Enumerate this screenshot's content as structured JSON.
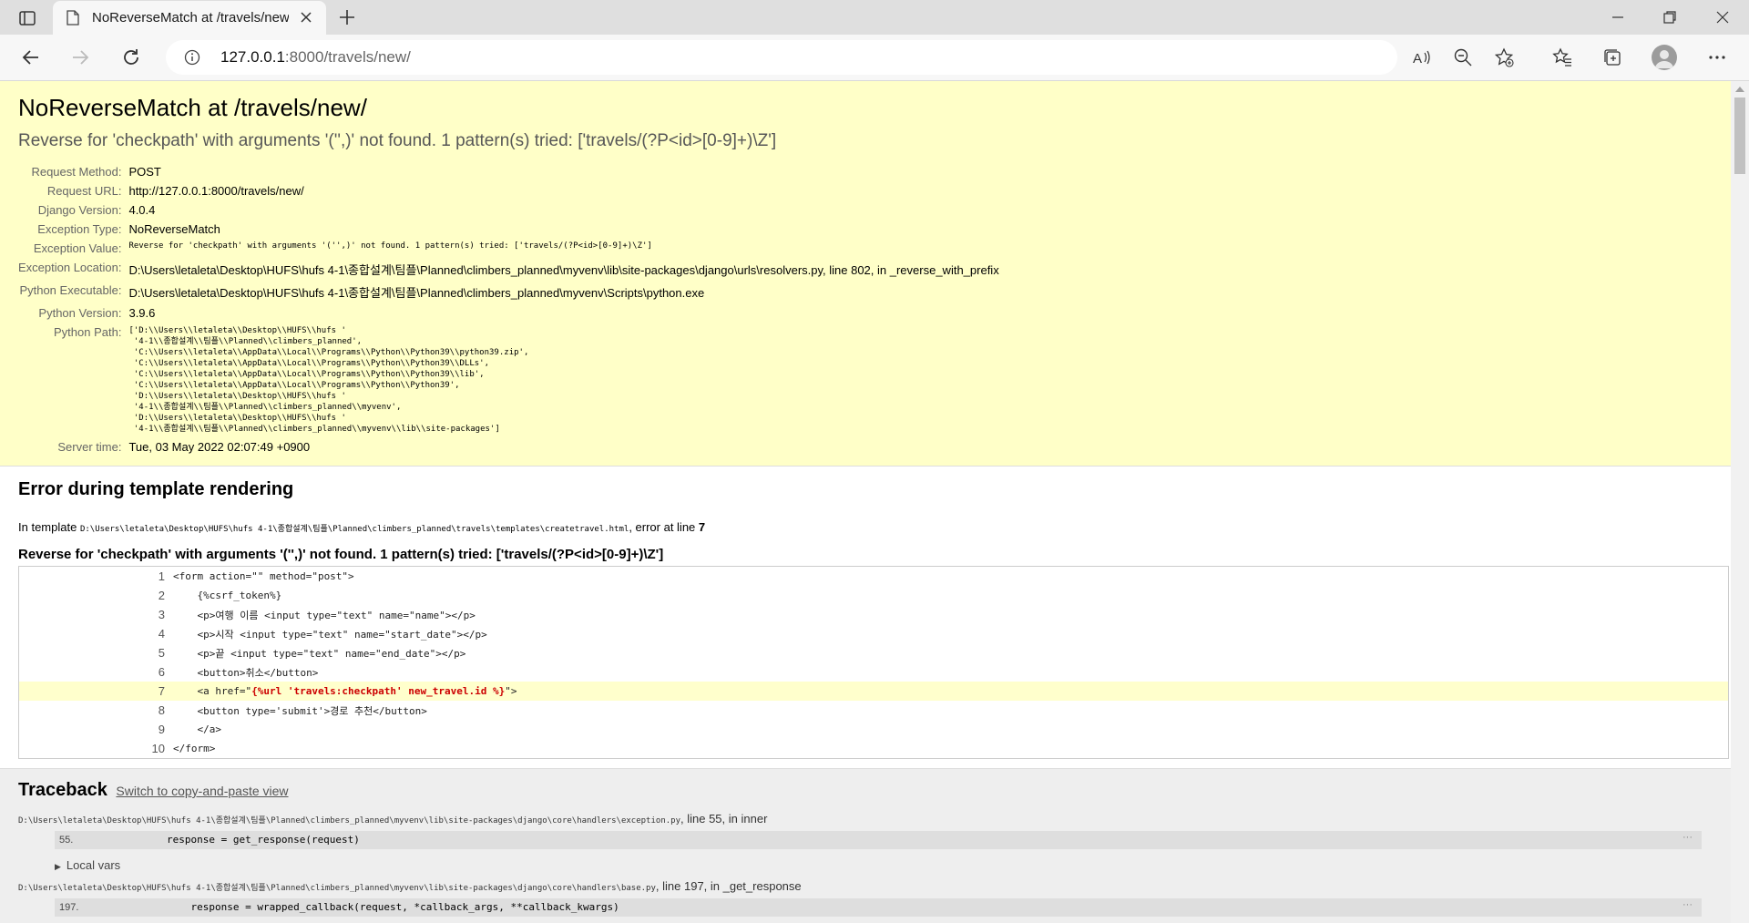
{
  "browser": {
    "tab_title": "NoReverseMatch at /travels/new/",
    "url_host": "127.0.0.1",
    "url_rest": ":8000/travels/new/"
  },
  "summary": {
    "heading": "NoReverseMatch at /travels/new/",
    "exception_value": "Reverse for 'checkpath' with arguments '('',)' not found. 1 pattern(s) tried: ['travels/(?P<id>[0-9]+)\\Z']",
    "rows": [
      {
        "label": "Request Method:",
        "value": "POST"
      },
      {
        "label": "Request URL:",
        "value": "http://127.0.0.1:8000/travels/new/"
      },
      {
        "label": "Django Version:",
        "value": "4.0.4"
      },
      {
        "label": "Exception Type:",
        "value": "NoReverseMatch"
      },
      {
        "label": "Exception Value:",
        "value": "Reverse for 'checkpath' with arguments '('',)' not found. 1 pattern(s) tried: ['travels/(?P<id>[0-9]+)\\Z']"
      },
      {
        "label": "Exception Location:",
        "value": "D:\\Users\\letaleta\\Desktop\\HUFS\\hufs 4-1\\종합설계\\팀플\\Planned\\climbers_planned\\myvenv\\lib\\site-packages\\django\\urls\\resolvers.py, line 802, in _reverse_with_prefix"
      },
      {
        "label": "Python Executable:",
        "value": "D:\\Users\\letaleta\\Desktop\\HUFS\\hufs 4-1\\종합설계\\팀플\\Planned\\climbers_planned\\myvenv\\Scripts\\python.exe"
      },
      {
        "label": "Python Version:",
        "value": "3.9.6"
      },
      {
        "label": "Python Path:",
        "value": "['D:\\\\Users\\\\letaleta\\\\Desktop\\\\HUFS\\\\hufs '\n '4-1\\\\종합설계\\\\팀플\\\\Planned\\\\climbers_planned',\n 'C:\\\\Users\\\\letaleta\\\\AppData\\\\Local\\\\Programs\\\\Python\\\\Python39\\\\python39.zip',\n 'C:\\\\Users\\\\letaleta\\\\AppData\\\\Local\\\\Programs\\\\Python\\\\Python39\\\\DLLs',\n 'C:\\\\Users\\\\letaleta\\\\AppData\\\\Local\\\\Programs\\\\Python\\\\Python39\\\\lib',\n 'C:\\\\Users\\\\letaleta\\\\AppData\\\\Local\\\\Programs\\\\Python\\\\Python39',\n 'D:\\\\Users\\\\letaleta\\\\Desktop\\\\HUFS\\\\hufs '\n '4-1\\\\종합설계\\\\팀플\\\\Planned\\\\climbers_planned\\\\myvenv',\n 'D:\\\\Users\\\\letaleta\\\\Desktop\\\\HUFS\\\\hufs '\n '4-1\\\\종합설계\\\\팀플\\\\Planned\\\\climbers_planned\\\\myvenv\\\\lib\\\\site-packages']"
      },
      {
        "label": "Server time:",
        "value": "Tue, 03 May 2022 02:07:49 +0900"
      }
    ]
  },
  "template_error": {
    "heading": "Error during template rendering",
    "intro_prefix": "In template ",
    "template_path": "D:\\Users\\letaleta\\Desktop\\HUFS\\hufs 4-1\\종합설계\\팀플\\Planned\\climbers_planned\\travels\\templates\\createtravel.html",
    "intro_suffix": ", error at line ",
    "error_line": "7",
    "message": "Reverse for 'checkpath' with arguments '('',)' not found. 1 pattern(s) tried: ['travels/(?P<id>[0-9]+)\\Z']",
    "source_lines": [
      {
        "n": "1",
        "code": "<form action=\"\" method=\"post\">"
      },
      {
        "n": "2",
        "code": "    {%csrf_token%}"
      },
      {
        "n": "3",
        "code": "    <p>여행 이름 <input type=\"text\" name=\"name\"></p>"
      },
      {
        "n": "4",
        "code": "    <p>시작 <input type=\"text\" name=\"start_date\"></p>"
      },
      {
        "n": "5",
        "code": "    <p>끝 <input type=\"text\" name=\"end_date\"></p>"
      },
      {
        "n": "6",
        "code": "    <button>취소</button>"
      },
      {
        "n": "7",
        "pre": "    <a href=\"",
        "hl": "{%url 'travels:checkpath' new_travel.id %}",
        "post": "\">"
      },
      {
        "n": "8",
        "code": "    <button type='submit'>경로 추천</button>"
      },
      {
        "n": "9",
        "code": "    </a>"
      },
      {
        "n": "10",
        "code": "</form>"
      }
    ]
  },
  "traceback": {
    "heading": "Traceback",
    "switch_link": "Switch to copy-and-paste view",
    "frames": [
      {
        "path": "D:\\Users\\letaleta\\Desktop\\HUFS\\hufs 4-1\\종합설계\\팀플\\Planned\\climbers_planned\\myvenv\\lib\\site-packages\\django\\core\\handlers\\exception.py",
        "suffix": ", line 55, in inner",
        "line_no": "55.",
        "code": "response = get_response(request)",
        "local_vars": "Local vars"
      },
      {
        "path": "D:\\Users\\letaleta\\Desktop\\HUFS\\hufs 4-1\\종합설계\\팀플\\Planned\\climbers_planned\\myvenv\\lib\\site-packages\\django\\core\\handlers\\base.py",
        "suffix": ", line 197, in _get_response",
        "line_no": "197.",
        "code": "    response = wrapped_callback(request, *callback_args, **callback_kwargs)",
        "local_vars": ""
      }
    ]
  }
}
